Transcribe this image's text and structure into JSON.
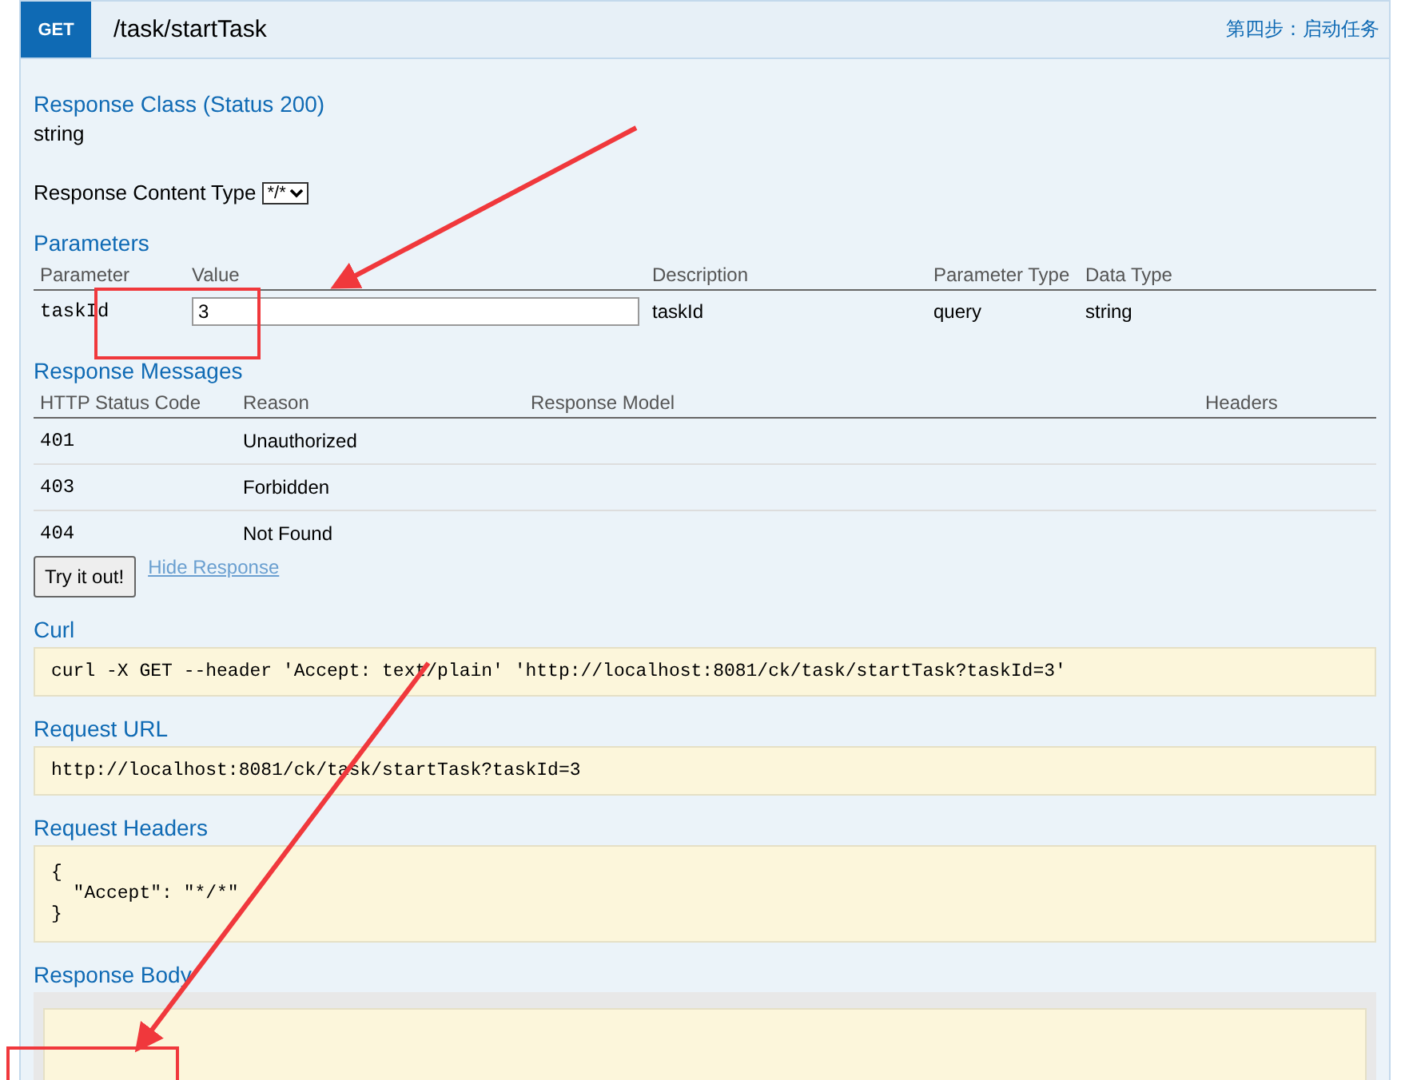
{
  "operation": {
    "method": "GET",
    "path": "/task/startTask",
    "summary": "第四步：启动任务"
  },
  "response_class": {
    "title": "Response Class (Status 200)",
    "type": "string"
  },
  "content_type": {
    "label": "Response Content Type",
    "value": "*/*"
  },
  "parameters": {
    "title": "Parameters",
    "columns": [
      "Parameter",
      "Value",
      "Description",
      "Parameter Type",
      "Data Type"
    ],
    "rows": [
      {
        "name": "taskId",
        "value": "3",
        "description": "taskId",
        "param_type": "query",
        "data_type": "string"
      }
    ]
  },
  "response_messages": {
    "title": "Response Messages",
    "columns": [
      "HTTP Status Code",
      "Reason",
      "Response Model",
      "Headers"
    ],
    "rows": [
      {
        "code": "401",
        "reason": "Unauthorized"
      },
      {
        "code": "403",
        "reason": "Forbidden"
      },
      {
        "code": "404",
        "reason": "Not Found"
      }
    ]
  },
  "try_button": "Try it out!",
  "hide_link": "Hide Response",
  "curl": {
    "title": "Curl",
    "text": "curl -X GET --header 'Accept: text/plain' 'http://localhost:8081/ck/task/startTask?taskId=3'"
  },
  "request_url": {
    "title": "Request URL",
    "text": "http://localhost:8081/ck/task/startTask?taskId=3"
  },
  "request_headers": {
    "title": "Request Headers",
    "lines": [
      "{",
      "  \"Accept\": \"*/*\"",
      "}"
    ]
  },
  "response_body": {
    "title": "Response Body"
  }
}
